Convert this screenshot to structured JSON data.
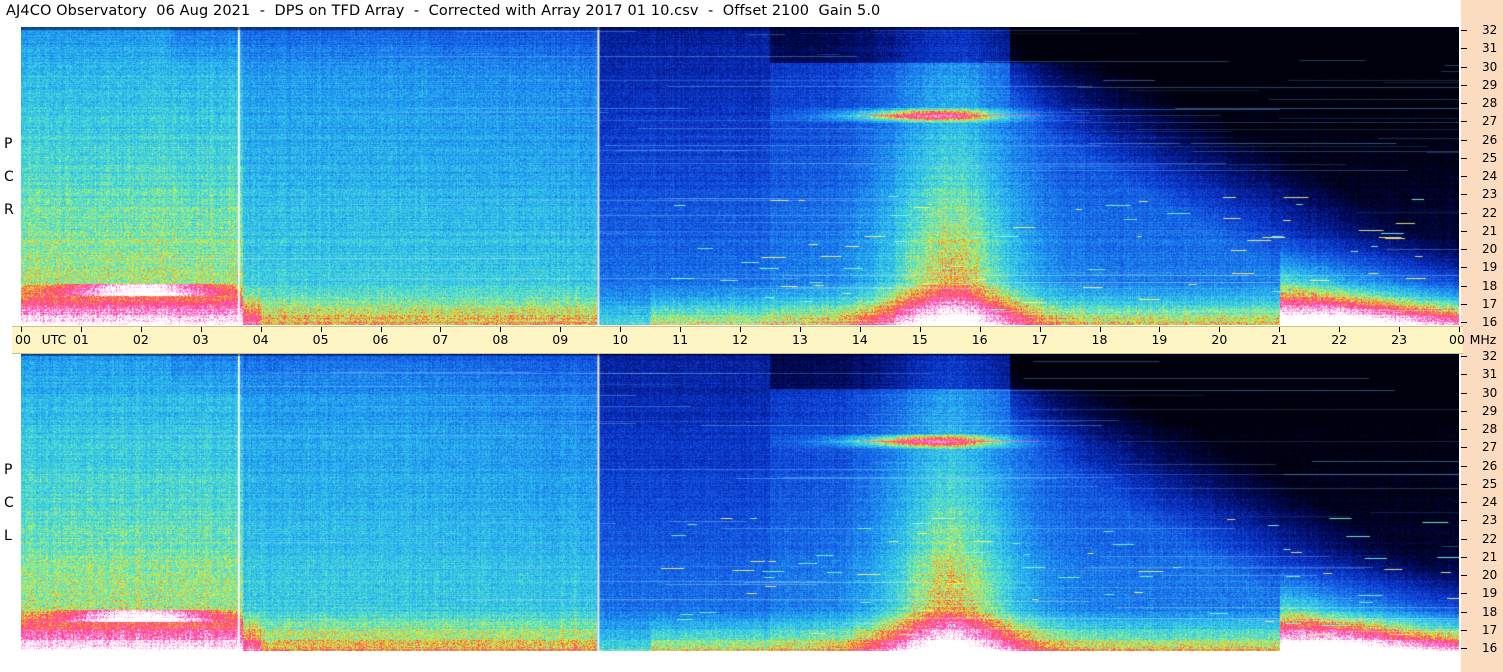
{
  "title": "AJ4CO Observatory  06 Aug 2021  -  DPS on TFD Array  -  Corrected with Array 2017 01 10.csv  -  Offset 2100  Gain 5.0",
  "panels": {
    "rcp": {
      "side_letters": [
        "P",
        "C",
        "R"
      ]
    },
    "lcp": {
      "side_letters": [
        "P",
        "C",
        "L"
      ]
    }
  },
  "time_axis": {
    "labels": [
      "00",
      "UTC",
      "01",
      "02",
      "03",
      "04",
      "05",
      "06",
      "07",
      "08",
      "09",
      "10",
      "11",
      "12",
      "13",
      "14",
      "15",
      "16",
      "17",
      "18",
      "19",
      "20",
      "21",
      "22",
      "23",
      "00",
      "MHz"
    ],
    "hour_labels": [
      "00",
      "01",
      "02",
      "03",
      "04",
      "05",
      "06",
      "07",
      "08",
      "09",
      "10",
      "11",
      "12",
      "13",
      "14",
      "15",
      "16",
      "17",
      "18",
      "19",
      "20",
      "21",
      "22",
      "23",
      "00"
    ],
    "utc_label": "UTC",
    "mhz_label": "MHz"
  },
  "frequency_axis": {
    "unit": "MHz",
    "ticks": [
      "32",
      "31",
      "30",
      "29",
      "28",
      "27",
      "26",
      "25",
      "24",
      "23",
      "22",
      "21",
      "20",
      "19",
      "18",
      "17",
      "16"
    ]
  },
  "colors": {
    "background": "#ffffff",
    "axis_bar": "#fdf6c4",
    "right_strip": "#fbdcc0",
    "quiet_night": "#000010",
    "deep_blue": "#0a2ea8",
    "bright_cyan": "#2ec4f0",
    "hot": "#ff40b0"
  }
}
